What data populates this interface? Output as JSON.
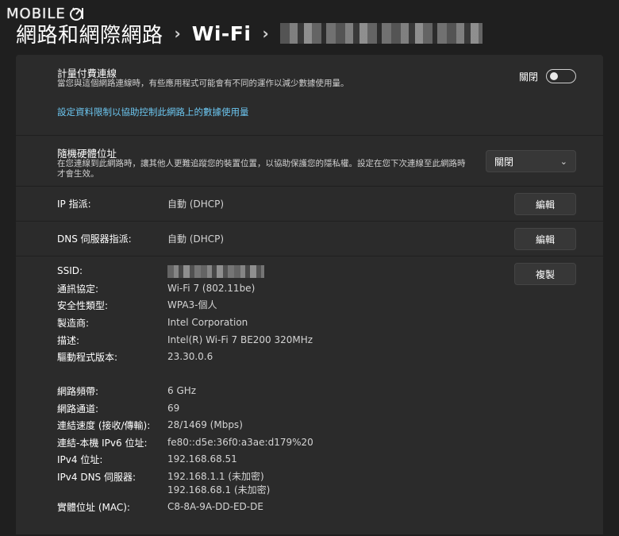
{
  "watermark": {
    "text": "MOBILE"
  },
  "breadcrumb": {
    "root": "網路和網際網路",
    "middle": "Wi-Fi",
    "separator": "›"
  },
  "metered": {
    "title": "計量付費連線",
    "description": "當您與這個網路連線時，有些應用程式可能會有不同的運作以減少數據使用量。",
    "toggle_label": "關閉",
    "toggle_on": false,
    "link": "設定資料限制以協助控制此網路上的數據使用量"
  },
  "random_mac": {
    "title": "隨機硬體位址",
    "description_line1": "在您連線到此網路時，讓其他人更難追蹤您的裝置位置，以協助保護您的隱私權。設定在您下次連線至此網路時",
    "description_line2": "才會生效。",
    "selected": "關閉"
  },
  "ip_assignment": {
    "label": "IP 指派:",
    "value": "自動 (DHCP)",
    "button": "編輯"
  },
  "dns_assignment": {
    "label": "DNS 伺服器指派:",
    "value": "自動 (DHCP)",
    "button": "編輯"
  },
  "properties": {
    "copy_button": "複製",
    "ssid_label": "SSID:",
    "rows": [
      {
        "label": "通訊協定:",
        "value": "Wi-Fi 7 (802.11be)"
      },
      {
        "label": "安全性類型:",
        "value": "WPA3-個人"
      },
      {
        "label": "製造商:",
        "value": "Intel Corporation"
      },
      {
        "label": "描述:",
        "value": "Intel(R) Wi-Fi 7 BE200 320MHz"
      },
      {
        "label": "驅動程式版本:",
        "value": "23.30.0.6"
      },
      {
        "label": "網路頻帶:",
        "value": "6 GHz"
      },
      {
        "label": "網路通道:",
        "value": "69"
      },
      {
        "label": "連結速度 (接收/傳輸):",
        "value": "28/1469 (Mbps)"
      },
      {
        "label": "連結-本機 IPv6 位址:",
        "value": "fe80::d5e:36f0:a3ae:d179%20"
      },
      {
        "label": "IPv4 位址:",
        "value": "192.168.68.51"
      },
      {
        "label": "IPv4 DNS 伺服器:",
        "value": "192.168.1.1 (未加密)",
        "value2": "192.168.68.1 (未加密)"
      },
      {
        "label": "實體位址 (MAC):",
        "value": "C8-8A-9A-DD-ED-DE"
      }
    ]
  }
}
